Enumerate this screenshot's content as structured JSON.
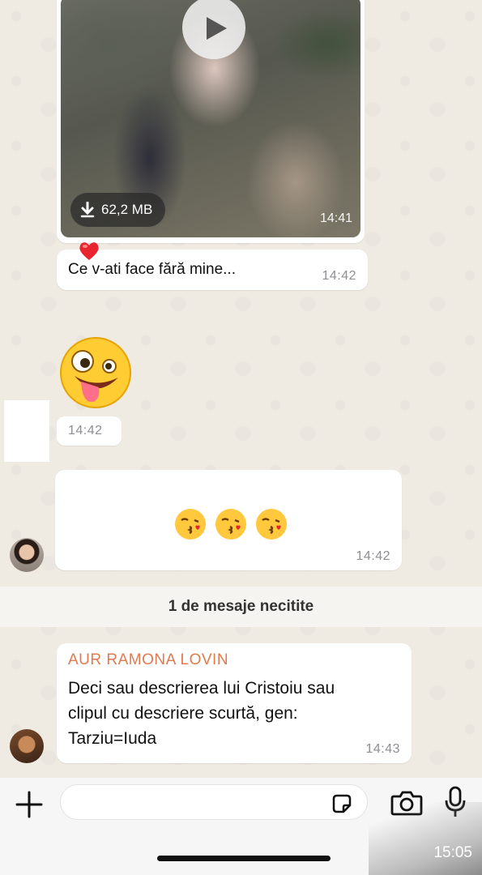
{
  "video_message": {
    "size_label": "62,2 MB",
    "time": "14:41"
  },
  "caption_message": {
    "text": "Ce v-ati face fără mine...",
    "time": "14:42",
    "reaction": "heart"
  },
  "emoji_message": {
    "emoji": "zany-face",
    "time": "14:42"
  },
  "kiss_message": {
    "emojis": [
      "😘",
      "😘",
      "😘"
    ],
    "time": "14:42"
  },
  "unread_separator": "1 de mesaje necitite",
  "text_message": {
    "sender": "AUR RAMONA LOVIN",
    "text": "Deci sau descrierea lui Cristoiu sau\nclipul cu descriere scurtă, gen:\nTarziu=Iuda",
    "time": "14:43"
  },
  "composer": {
    "placeholder": ""
  },
  "status_time": "15:05",
  "colors": {
    "chat_background": "#efeae2",
    "bubble": "#ffffff",
    "sender_name": "#e07a4f"
  }
}
